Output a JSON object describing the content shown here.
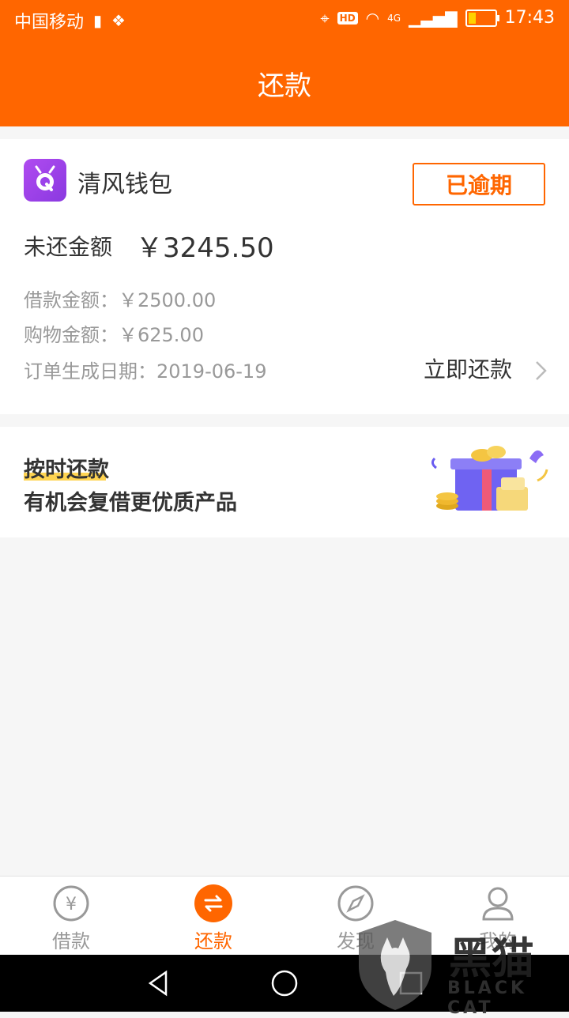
{
  "status_bar": {
    "carrier": "中国移动",
    "network": "4G",
    "hd_label": "HD",
    "time": "17:43"
  },
  "header": {
    "title": "还款"
  },
  "loan_card": {
    "app_name": "清风钱包",
    "status_badge": "已逾期",
    "unpaid_label": "未还金额",
    "unpaid_amount": "￥3245.50",
    "loan_amount_line": "借款金额：￥2500.00",
    "shopping_amount_line": "购物金额：￥625.00",
    "order_date_line": "订单生成日期：2019-06-19",
    "repay_now": "立即还款"
  },
  "promo": {
    "line1": "按时还款",
    "line2": "有机会复借更优质产品"
  },
  "tabs": [
    {
      "label": "借款",
      "icon": "loan-icon",
      "active": false
    },
    {
      "label": "还款",
      "icon": "repay-icon",
      "active": true
    },
    {
      "label": "发现",
      "icon": "compass-icon",
      "active": false
    },
    {
      "label": "我的",
      "icon": "user-icon",
      "active": false
    }
  ],
  "watermark": {
    "text": "黑猫",
    "sub": "BLACK CAT"
  },
  "colors": {
    "accent": "#ff6600",
    "badge_bar": "#ffcc33"
  }
}
